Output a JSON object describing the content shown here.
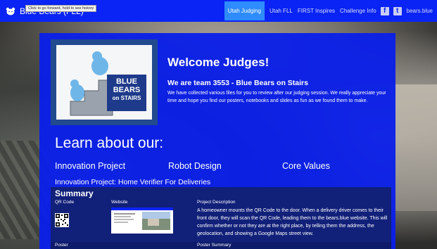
{
  "nav": {
    "brand_title": "Blue Bears (FLL)",
    "tooltip": "Click to go forward, hold to see history",
    "links": [
      {
        "label": "Utah Judging",
        "active": true
      },
      {
        "label": "Utah FLL"
      },
      {
        "label": "FIRST Inspires"
      },
      {
        "label": "Challenge Info"
      }
    ],
    "social": [
      {
        "icon": "facebook-icon",
        "glyph": "f"
      },
      {
        "icon": "twitter-icon",
        "glyph": "t"
      }
    ],
    "site_link": "bears.blue"
  },
  "hero": {
    "logo_text": [
      "BLUE",
      "BEARS",
      "on STAIRS"
    ],
    "welcome": "Welcome Judges!",
    "team": "We are team 3553 - Blue Bears on Stairs",
    "intro": "We have collected various files for you to review after our judging session. We really appreciate your time and hope you find our posters, notebooks and slides as fun as we found them to make."
  },
  "learn": {
    "heading": "Learn about our:",
    "topics": [
      "Innovation Project",
      "Robot Design",
      "Core Values"
    ]
  },
  "project": {
    "title": "Innovation Project: Home Verifier For Deliveries",
    "summary": {
      "heading": "Summary",
      "columns": [
        "QR Code",
        "Website",
        "Project Description"
      ],
      "description": "A homeowner mounts the QR Code to the door. When a delivery driver comes to their front door, they will scan the QR Code, leading them to the bears.blue website. This will confirm whether or not they are at the right place, by telling them the address, the geolocation, and showing a Google Maps street view.",
      "next_columns": [
        "Poster",
        "Poster Summary"
      ]
    }
  },
  "colors": {
    "nav": "#0a24f5",
    "panel": "#0a1fe8",
    "summary": "#112079",
    "active_tab": "#2f8cff"
  }
}
